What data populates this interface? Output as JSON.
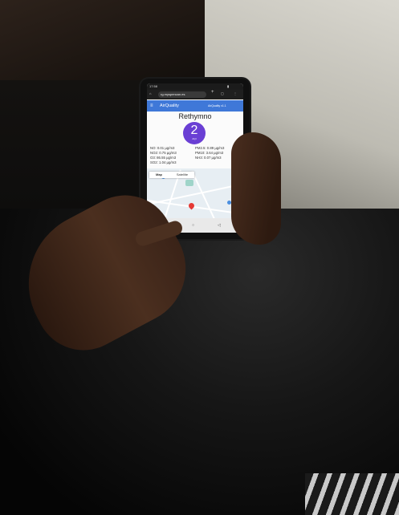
{
  "phone": {
    "status": {
      "time": "17:58"
    },
    "browser": {
      "url": "rg.myspencan.es"
    },
    "app": {
      "title": "AirQuality",
      "version": "AirQuality v1.1"
    },
    "city": "Rethymno",
    "aqi": {
      "value": "2",
      "unit": "AQI"
    },
    "pollutants": [
      {
        "left": "NO: 0.01 µg/m3",
        "right": "PM2.5: 0.89 µg/m3"
      },
      {
        "left": "NO2: 0.75 µg/m3",
        "right": "PM10: 3.64 µg/m3"
      },
      {
        "left": "O3: 86.55 µg/m3",
        "right": "NH3: 0.07 µg/m3"
      },
      {
        "left": "SO2: 1.04 µg/m3",
        "right": ""
      }
    ],
    "map": {
      "tab_map": "Map",
      "tab_satellite": "Satellite"
    }
  },
  "colors": {
    "app_bar": "#3f78d8",
    "aqi_circle": "#6a3fd4",
    "marker": "#e53935"
  }
}
